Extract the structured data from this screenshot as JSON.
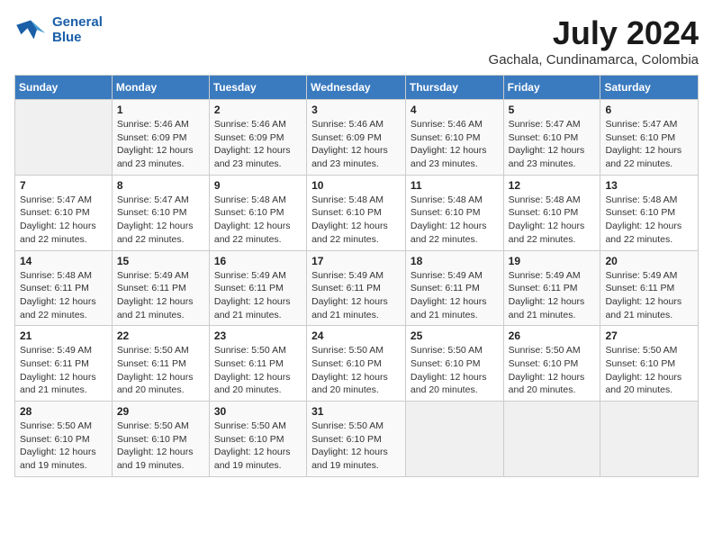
{
  "header": {
    "logo_line1": "General",
    "logo_line2": "Blue",
    "month_year": "July 2024",
    "location": "Gachala, Cundinamarca, Colombia"
  },
  "days_of_week": [
    "Sunday",
    "Monday",
    "Tuesday",
    "Wednesday",
    "Thursday",
    "Friday",
    "Saturday"
  ],
  "weeks": [
    [
      {
        "day": "",
        "info": ""
      },
      {
        "day": "1",
        "info": "Sunrise: 5:46 AM\nSunset: 6:09 PM\nDaylight: 12 hours\nand 23 minutes."
      },
      {
        "day": "2",
        "info": "Sunrise: 5:46 AM\nSunset: 6:09 PM\nDaylight: 12 hours\nand 23 minutes."
      },
      {
        "day": "3",
        "info": "Sunrise: 5:46 AM\nSunset: 6:09 PM\nDaylight: 12 hours\nand 23 minutes."
      },
      {
        "day": "4",
        "info": "Sunrise: 5:46 AM\nSunset: 6:10 PM\nDaylight: 12 hours\nand 23 minutes."
      },
      {
        "day": "5",
        "info": "Sunrise: 5:47 AM\nSunset: 6:10 PM\nDaylight: 12 hours\nand 23 minutes."
      },
      {
        "day": "6",
        "info": "Sunrise: 5:47 AM\nSunset: 6:10 PM\nDaylight: 12 hours\nand 22 minutes."
      }
    ],
    [
      {
        "day": "7",
        "info": "Sunrise: 5:47 AM\nSunset: 6:10 PM\nDaylight: 12 hours\nand 22 minutes."
      },
      {
        "day": "8",
        "info": "Sunrise: 5:47 AM\nSunset: 6:10 PM\nDaylight: 12 hours\nand 22 minutes."
      },
      {
        "day": "9",
        "info": "Sunrise: 5:48 AM\nSunset: 6:10 PM\nDaylight: 12 hours\nand 22 minutes."
      },
      {
        "day": "10",
        "info": "Sunrise: 5:48 AM\nSunset: 6:10 PM\nDaylight: 12 hours\nand 22 minutes."
      },
      {
        "day": "11",
        "info": "Sunrise: 5:48 AM\nSunset: 6:10 PM\nDaylight: 12 hours\nand 22 minutes."
      },
      {
        "day": "12",
        "info": "Sunrise: 5:48 AM\nSunset: 6:10 PM\nDaylight: 12 hours\nand 22 minutes."
      },
      {
        "day": "13",
        "info": "Sunrise: 5:48 AM\nSunset: 6:10 PM\nDaylight: 12 hours\nand 22 minutes."
      }
    ],
    [
      {
        "day": "14",
        "info": "Sunrise: 5:48 AM\nSunset: 6:11 PM\nDaylight: 12 hours\nand 22 minutes."
      },
      {
        "day": "15",
        "info": "Sunrise: 5:49 AM\nSunset: 6:11 PM\nDaylight: 12 hours\nand 21 minutes."
      },
      {
        "day": "16",
        "info": "Sunrise: 5:49 AM\nSunset: 6:11 PM\nDaylight: 12 hours\nand 21 minutes."
      },
      {
        "day": "17",
        "info": "Sunrise: 5:49 AM\nSunset: 6:11 PM\nDaylight: 12 hours\nand 21 minutes."
      },
      {
        "day": "18",
        "info": "Sunrise: 5:49 AM\nSunset: 6:11 PM\nDaylight: 12 hours\nand 21 minutes."
      },
      {
        "day": "19",
        "info": "Sunrise: 5:49 AM\nSunset: 6:11 PM\nDaylight: 12 hours\nand 21 minutes."
      },
      {
        "day": "20",
        "info": "Sunrise: 5:49 AM\nSunset: 6:11 PM\nDaylight: 12 hours\nand 21 minutes."
      }
    ],
    [
      {
        "day": "21",
        "info": "Sunrise: 5:49 AM\nSunset: 6:11 PM\nDaylight: 12 hours\nand 21 minutes."
      },
      {
        "day": "22",
        "info": "Sunrise: 5:50 AM\nSunset: 6:11 PM\nDaylight: 12 hours\nand 20 minutes."
      },
      {
        "day": "23",
        "info": "Sunrise: 5:50 AM\nSunset: 6:11 PM\nDaylight: 12 hours\nand 20 minutes."
      },
      {
        "day": "24",
        "info": "Sunrise: 5:50 AM\nSunset: 6:10 PM\nDaylight: 12 hours\nand 20 minutes."
      },
      {
        "day": "25",
        "info": "Sunrise: 5:50 AM\nSunset: 6:10 PM\nDaylight: 12 hours\nand 20 minutes."
      },
      {
        "day": "26",
        "info": "Sunrise: 5:50 AM\nSunset: 6:10 PM\nDaylight: 12 hours\nand 20 minutes."
      },
      {
        "day": "27",
        "info": "Sunrise: 5:50 AM\nSunset: 6:10 PM\nDaylight: 12 hours\nand 20 minutes."
      }
    ],
    [
      {
        "day": "28",
        "info": "Sunrise: 5:50 AM\nSunset: 6:10 PM\nDaylight: 12 hours\nand 19 minutes."
      },
      {
        "day": "29",
        "info": "Sunrise: 5:50 AM\nSunset: 6:10 PM\nDaylight: 12 hours\nand 19 minutes."
      },
      {
        "day": "30",
        "info": "Sunrise: 5:50 AM\nSunset: 6:10 PM\nDaylight: 12 hours\nand 19 minutes."
      },
      {
        "day": "31",
        "info": "Sunrise: 5:50 AM\nSunset: 6:10 PM\nDaylight: 12 hours\nand 19 minutes."
      },
      {
        "day": "",
        "info": ""
      },
      {
        "day": "",
        "info": ""
      },
      {
        "day": "",
        "info": ""
      }
    ]
  ]
}
